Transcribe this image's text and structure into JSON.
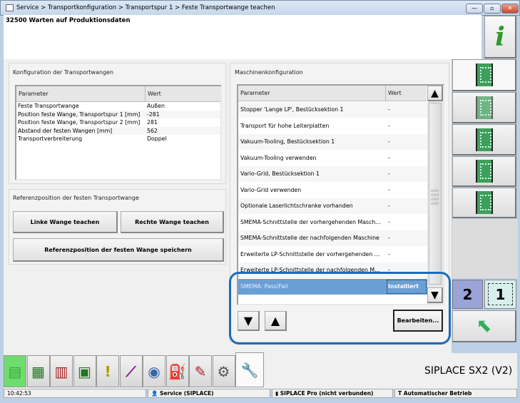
{
  "window": {
    "breadcrumb": "Service > Transportkonfiguration > Transportspur 1 > Feste Transportwange teachen",
    "minimize": "—",
    "maximize": "▫",
    "close": "✕"
  },
  "header": {
    "message": "32500 Warten auf Produktionsdaten",
    "info_label": "i"
  },
  "left_panel": {
    "title": "Konfiguration der Transportwangen",
    "col_param": "Parameter",
    "col_value": "Wert",
    "rows": [
      {
        "p": "Feste Transportwange",
        "v": "Außen"
      },
      {
        "p": "Position feste Wange, Transportspur 1 [mm]",
        "v": "-281"
      },
      {
        "p": "Position feste Wange, Transportspur 2 [mm]",
        "v": "281"
      },
      {
        "p": "Abstand der festen Wangen [mm]",
        "v": "562"
      },
      {
        "p": "Transportverbreiterung",
        "v": "Doppel"
      }
    ]
  },
  "ref_panel": {
    "title": "Referenzposition der festen Transportwange",
    "left_btn": "Linke Wange teachen",
    "right_btn": "Rechte Wange teachen",
    "save_btn": "Referenzposition der festen Wange speichern"
  },
  "machine_panel": {
    "title": "Maschinenkonfiguration",
    "col_param": "Parameter",
    "col_value": "Wert",
    "rows": [
      {
        "p": "Stopper 'Lange LP', Bestücksektion 1",
        "v": "-"
      },
      {
        "p": "Transport für hohe Leiterplatten",
        "v": "-"
      },
      {
        "p": "Vakuum-Tooling, Bestücksektion 1",
        "v": "-"
      },
      {
        "p": "Vakuum-Tooling verwenden",
        "v": "-"
      },
      {
        "p": "Vario-Grid, Bestücksektion 1",
        "v": "-"
      },
      {
        "p": "Vario-Grid verwenden",
        "v": "-"
      },
      {
        "p": "Optionale Laserlichtschranke vorhanden",
        "v": "-"
      },
      {
        "p": "SMEMA-Schnittstelle der vorhergehenden Masch...",
        "v": "-"
      },
      {
        "p": "SMEMA-Schnittstelle der nachfolgenden Maschine",
        "v": "-"
      },
      {
        "p": "Erweiterte LP-Schnittstelle der vorhergehenden ...",
        "v": "-"
      },
      {
        "p": "Erweiterte LP-Schnittstelle der nachfolgenden M...",
        "v": "-"
      },
      {
        "p": "SMEMA: Pass/Fail",
        "v": "Installiert"
      }
    ],
    "edit_btn": "Bearbeiten...",
    "highlight_color": "#1a6bbf",
    "selected_color": "#6a9fd4"
  },
  "side": {
    "lane2": "2",
    "lane1": "1"
  },
  "toolbar": {
    "machine": "SIPLACE SX2 (V2)"
  },
  "status": {
    "time": "10:42:53",
    "user": "Service (SIPLACE)",
    "pro": "SIPLACE Pro (nicht verbunden)",
    "mode": "Automatischer Betrieb"
  }
}
